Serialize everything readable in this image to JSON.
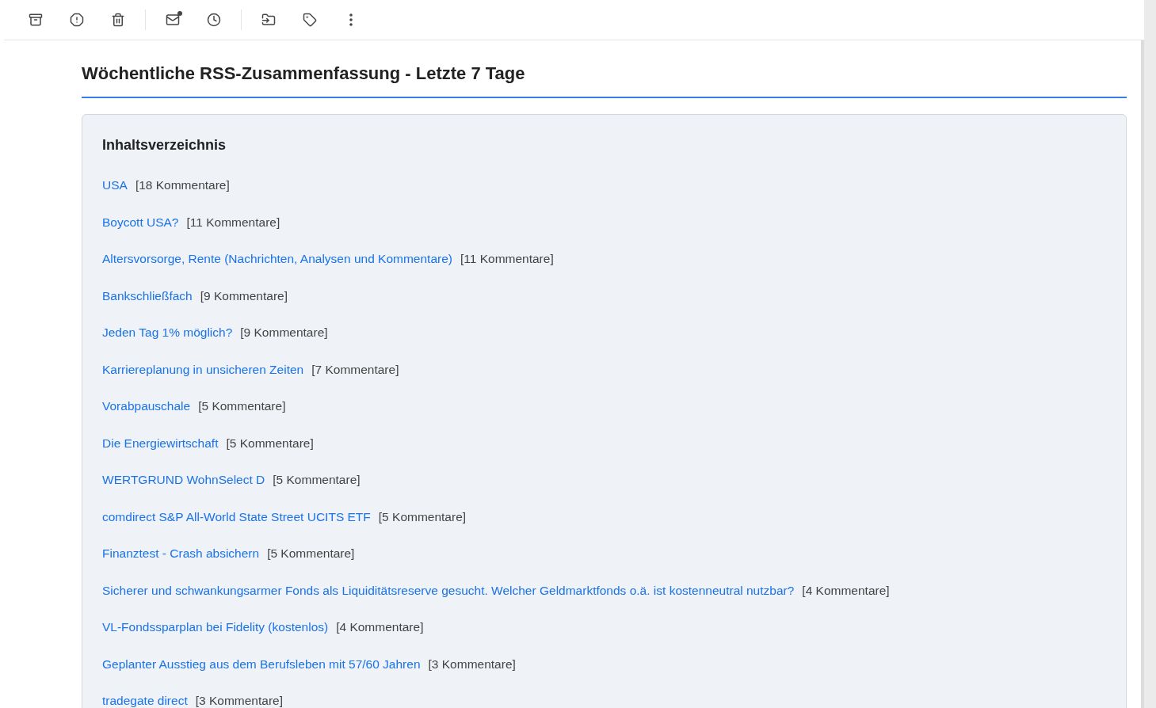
{
  "email": {
    "title": "Wöchentliche RSS-Zusammenfassung - Letzte 7 Tage",
    "toc": {
      "heading": "Inhaltsverzeichnis",
      "items": [
        {
          "title": "USA",
          "comments": "[18 Kommentare]"
        },
        {
          "title": "Boycott USA?",
          "comments": "[11 Kommentare]"
        },
        {
          "title": "Altersvorsorge, Rente (Nachrichten, Analysen und Kommentare)",
          "comments": "[11 Kommentare]"
        },
        {
          "title": "Bankschließfach",
          "comments": "[9 Kommentare]"
        },
        {
          "title": "Jeden Tag 1% möglich?",
          "comments": "[9 Kommentare]"
        },
        {
          "title": "Karriereplanung in unsicheren Zeiten",
          "comments": "[7 Kommentare]"
        },
        {
          "title": "Vorabpauschale",
          "comments": "[5 Kommentare]"
        },
        {
          "title": "Die Energiewirtschaft",
          "comments": "[5 Kommentare]"
        },
        {
          "title": "WERTGRUND WohnSelect D",
          "comments": "[5 Kommentare]"
        },
        {
          "title": "comdirect S&P All-World State Street UCITS ETF",
          "comments": "[5 Kommentare]"
        },
        {
          "title": "Finanztest - Crash absichern",
          "comments": "[5 Kommentare]"
        },
        {
          "title": "Sicherer und schwankungsarmer Fonds als Liquiditätsreserve gesucht. Welcher Geldmarktfonds o.ä. ist kostenneutral nutzbar?",
          "comments": "[4 Kommentare]"
        },
        {
          "title": "VL-Fondssparplan bei Fidelity (kostenlos)",
          "comments": "[4 Kommentare]"
        },
        {
          "title": "Geplanter Ausstieg aus dem Berufsleben mit 57/60 Jahren",
          "comments": "[3 Kommentare]"
        },
        {
          "title": "tradegate direct",
          "comments": "[3 Kommentare]"
        }
      ]
    }
  }
}
